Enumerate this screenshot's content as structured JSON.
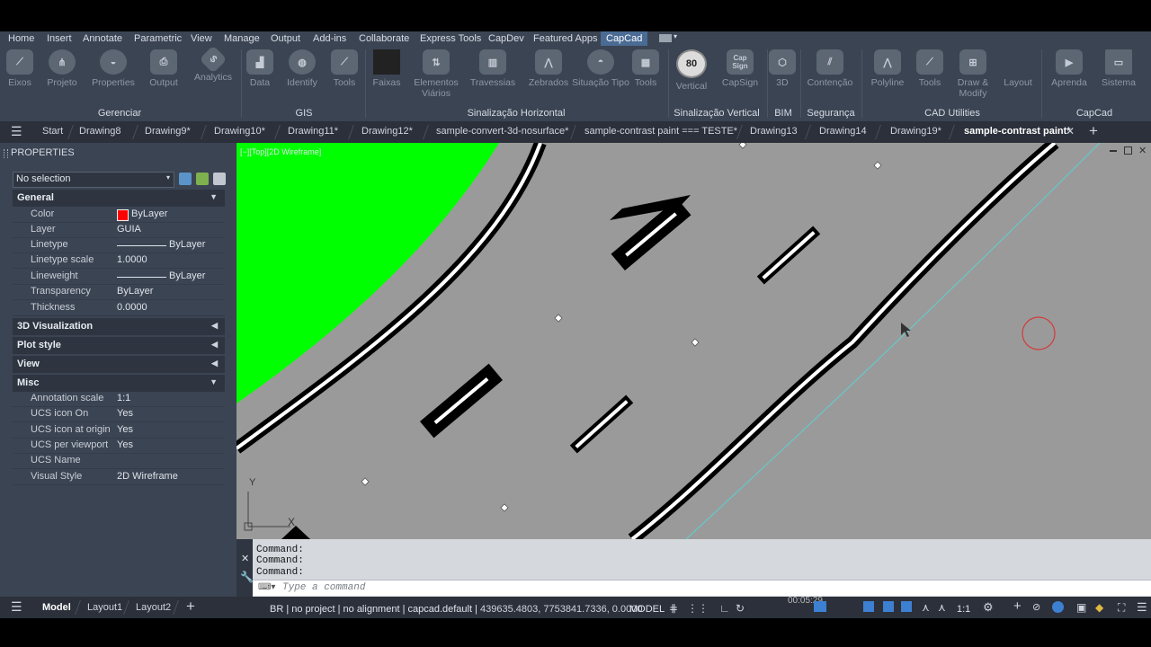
{
  "menubar": {
    "items": [
      "Home",
      "Insert",
      "Annotate",
      "Parametric",
      "View",
      "Manage",
      "Output",
      "Add-ins",
      "Collaborate",
      "Express Tools",
      "CapDev",
      "Featured Apps",
      "CapCad"
    ],
    "active": "CapCad"
  },
  "ribbon": {
    "tools": [
      {
        "label": "Eixos",
        "icon": "axis-icon"
      },
      {
        "label": "Projeto",
        "icon": "project-icon"
      },
      {
        "label": "Properties",
        "icon": "properties-icon"
      },
      {
        "label": "Output",
        "icon": "printer-icon"
      },
      {
        "label": "Analytics",
        "icon": "analytics-icon"
      },
      {
        "label": "Data",
        "icon": "map-icon"
      },
      {
        "label": "Identify",
        "icon": "globe-icon"
      },
      {
        "label": "Tools",
        "icon": "wrench-icon"
      },
      {
        "label": "Faixas",
        "icon": "stripe-icon"
      },
      {
        "label": "Elementos Viários",
        "icon": "road-elements-icon"
      },
      {
        "label": "Travessias",
        "icon": "crosswalk-icon"
      },
      {
        "label": "Zebrados",
        "icon": "zebra-icon"
      },
      {
        "label": "Situação Tipo",
        "icon": "situation-icon"
      },
      {
        "label": "Tools",
        "icon": "tools-icon"
      },
      {
        "label": "Vertical",
        "icon": "speed-sign-icon",
        "badge": "80"
      },
      {
        "label": "CapSign",
        "icon": "capsign-icon",
        "badge": "Cap Sign"
      },
      {
        "label": "3D",
        "icon": "cube-icon"
      },
      {
        "label": "Contenção",
        "icon": "barrier-icon"
      },
      {
        "label": "Polyline",
        "icon": "polyline-icon"
      },
      {
        "label": "Tools",
        "icon": "tools2-icon"
      },
      {
        "label": "Draw & Modify",
        "icon": "draw-modify-icon"
      },
      {
        "label": "Layout",
        "icon": "layout-icon"
      },
      {
        "label": "Aprenda",
        "icon": "play-icon"
      },
      {
        "label": "Sistema",
        "icon": "system-icon"
      }
    ],
    "panels": [
      "Gerenciar",
      "GIS",
      "Sinalização Horizontal",
      "Sinalização Vertical",
      "BIM",
      "Segurança",
      "CAD Utilities",
      "CapCad"
    ]
  },
  "tabs": {
    "items": [
      "Start",
      "Drawing8",
      "Drawing9*",
      "Drawing10*",
      "Drawing11*",
      "Drawing12*",
      "sample-convert-3d-nosurface*",
      "sample-contrast paint === TESTE*",
      "Drawing13",
      "Drawing14",
      "Drawing19*",
      "sample-contrast paint*"
    ],
    "active": "sample-contrast paint*"
  },
  "properties": {
    "title": "PROPERTIES",
    "selection": "No selection",
    "general": {
      "header": "General",
      "rows": [
        {
          "key": "Color",
          "value": "ByLayer",
          "swatch": "#ff0000"
        },
        {
          "key": "Layer",
          "value": "GUIA"
        },
        {
          "key": "Linetype",
          "value": "ByLayer",
          "line": true
        },
        {
          "key": "Linetype scale",
          "value": "1.0000"
        },
        {
          "key": "Lineweight",
          "value": "ByLayer",
          "line": true
        },
        {
          "key": "Transparency",
          "value": "ByLayer"
        },
        {
          "key": "Thickness",
          "value": "0.0000"
        }
      ]
    },
    "collapsed": [
      "3D Visualization",
      "Plot style",
      "View"
    ],
    "misc": {
      "header": "Misc",
      "rows": [
        {
          "key": "Annotation scale",
          "value": "1:1"
        },
        {
          "key": "UCS icon On",
          "value": "Yes"
        },
        {
          "key": "UCS icon at origin",
          "value": "Yes"
        },
        {
          "key": "UCS per viewport",
          "value": "Yes"
        },
        {
          "key": "UCS Name",
          "value": ""
        },
        {
          "key": "Visual Style",
          "value": "2D Wireframe"
        }
      ]
    }
  },
  "viewport": {
    "label": "[−][Top][2D Wireframe]",
    "ucs_x": "X",
    "ucs_y": "Y"
  },
  "command": {
    "history": [
      "Command:",
      "Command:",
      "Command:"
    ],
    "placeholder": "Type a command"
  },
  "status": {
    "layout_tabs": [
      "Model",
      "Layout1",
      "Layout2"
    ],
    "active_layout": "Model",
    "info": "BR | no project | no alignment | capcad.default |",
    "coords": "439635.4803, 7753841.7336, 0.0000",
    "space": "MODEL",
    "scale": "1:1",
    "clock": "00:05:29"
  }
}
